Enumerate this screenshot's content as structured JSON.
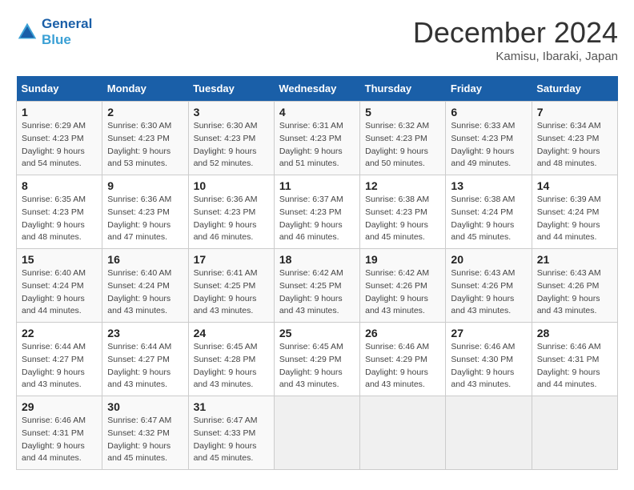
{
  "header": {
    "logo_line1": "General",
    "logo_line2": "Blue",
    "month": "December 2024",
    "location": "Kamisu, Ibaraki, Japan"
  },
  "weekdays": [
    "Sunday",
    "Monday",
    "Tuesday",
    "Wednesday",
    "Thursday",
    "Friday",
    "Saturday"
  ],
  "weeks": [
    [
      {
        "day": "1",
        "sunrise": "6:29 AM",
        "sunset": "4:23 PM",
        "daylight": "9 hours and 54 minutes."
      },
      {
        "day": "2",
        "sunrise": "6:30 AM",
        "sunset": "4:23 PM",
        "daylight": "9 hours and 53 minutes."
      },
      {
        "day": "3",
        "sunrise": "6:30 AM",
        "sunset": "4:23 PM",
        "daylight": "9 hours and 52 minutes."
      },
      {
        "day": "4",
        "sunrise": "6:31 AM",
        "sunset": "4:23 PM",
        "daylight": "9 hours and 51 minutes."
      },
      {
        "day": "5",
        "sunrise": "6:32 AM",
        "sunset": "4:23 PM",
        "daylight": "9 hours and 50 minutes."
      },
      {
        "day": "6",
        "sunrise": "6:33 AM",
        "sunset": "4:23 PM",
        "daylight": "9 hours and 49 minutes."
      },
      {
        "day": "7",
        "sunrise": "6:34 AM",
        "sunset": "4:23 PM",
        "daylight": "9 hours and 48 minutes."
      }
    ],
    [
      {
        "day": "8",
        "sunrise": "6:35 AM",
        "sunset": "4:23 PM",
        "daylight": "9 hours and 48 minutes."
      },
      {
        "day": "9",
        "sunrise": "6:36 AM",
        "sunset": "4:23 PM",
        "daylight": "9 hours and 47 minutes."
      },
      {
        "day": "10",
        "sunrise": "6:36 AM",
        "sunset": "4:23 PM",
        "daylight": "9 hours and 46 minutes."
      },
      {
        "day": "11",
        "sunrise": "6:37 AM",
        "sunset": "4:23 PM",
        "daylight": "9 hours and 46 minutes."
      },
      {
        "day": "12",
        "sunrise": "6:38 AM",
        "sunset": "4:23 PM",
        "daylight": "9 hours and 45 minutes."
      },
      {
        "day": "13",
        "sunrise": "6:38 AM",
        "sunset": "4:24 PM",
        "daylight": "9 hours and 45 minutes."
      },
      {
        "day": "14",
        "sunrise": "6:39 AM",
        "sunset": "4:24 PM",
        "daylight": "9 hours and 44 minutes."
      }
    ],
    [
      {
        "day": "15",
        "sunrise": "6:40 AM",
        "sunset": "4:24 PM",
        "daylight": "9 hours and 44 minutes."
      },
      {
        "day": "16",
        "sunrise": "6:40 AM",
        "sunset": "4:24 PM",
        "daylight": "9 hours and 43 minutes."
      },
      {
        "day": "17",
        "sunrise": "6:41 AM",
        "sunset": "4:25 PM",
        "daylight": "9 hours and 43 minutes."
      },
      {
        "day": "18",
        "sunrise": "6:42 AM",
        "sunset": "4:25 PM",
        "daylight": "9 hours and 43 minutes."
      },
      {
        "day": "19",
        "sunrise": "6:42 AM",
        "sunset": "4:26 PM",
        "daylight": "9 hours and 43 minutes."
      },
      {
        "day": "20",
        "sunrise": "6:43 AM",
        "sunset": "4:26 PM",
        "daylight": "9 hours and 43 minutes."
      },
      {
        "day": "21",
        "sunrise": "6:43 AM",
        "sunset": "4:26 PM",
        "daylight": "9 hours and 43 minutes."
      }
    ],
    [
      {
        "day": "22",
        "sunrise": "6:44 AM",
        "sunset": "4:27 PM",
        "daylight": "9 hours and 43 minutes."
      },
      {
        "day": "23",
        "sunrise": "6:44 AM",
        "sunset": "4:27 PM",
        "daylight": "9 hours and 43 minutes."
      },
      {
        "day": "24",
        "sunrise": "6:45 AM",
        "sunset": "4:28 PM",
        "daylight": "9 hours and 43 minutes."
      },
      {
        "day": "25",
        "sunrise": "6:45 AM",
        "sunset": "4:29 PM",
        "daylight": "9 hours and 43 minutes."
      },
      {
        "day": "26",
        "sunrise": "6:46 AM",
        "sunset": "4:29 PM",
        "daylight": "9 hours and 43 minutes."
      },
      {
        "day": "27",
        "sunrise": "6:46 AM",
        "sunset": "4:30 PM",
        "daylight": "9 hours and 43 minutes."
      },
      {
        "day": "28",
        "sunrise": "6:46 AM",
        "sunset": "4:31 PM",
        "daylight": "9 hours and 44 minutes."
      }
    ],
    [
      {
        "day": "29",
        "sunrise": "6:46 AM",
        "sunset": "4:31 PM",
        "daylight": "9 hours and 44 minutes."
      },
      {
        "day": "30",
        "sunrise": "6:47 AM",
        "sunset": "4:32 PM",
        "daylight": "9 hours and 45 minutes."
      },
      {
        "day": "31",
        "sunrise": "6:47 AM",
        "sunset": "4:33 PM",
        "daylight": "9 hours and 45 minutes."
      },
      null,
      null,
      null,
      null
    ]
  ]
}
